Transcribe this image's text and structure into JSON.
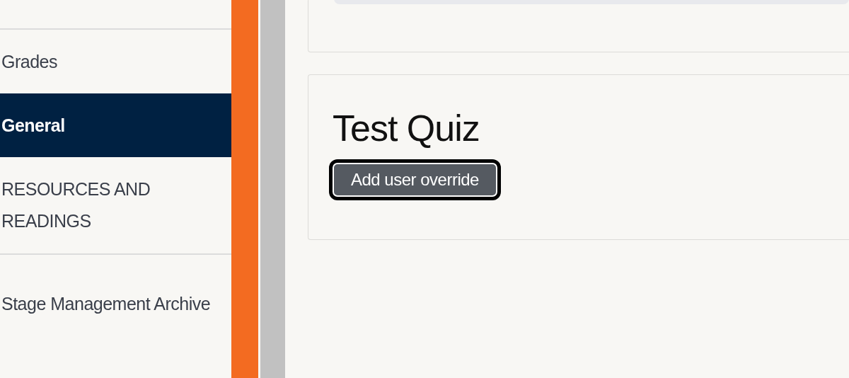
{
  "sidebar": {
    "items": [
      {
        "label": "Grades",
        "selected": false
      },
      {
        "label": "General",
        "selected": true
      },
      {
        "label": "RESOURCES AND READINGS",
        "selected": false
      },
      {
        "label": "Stage Management Archive",
        "selected": false
      }
    ]
  },
  "quiz": {
    "title": "Test Quiz",
    "button": "Add user override",
    "button_focused": true
  }
}
